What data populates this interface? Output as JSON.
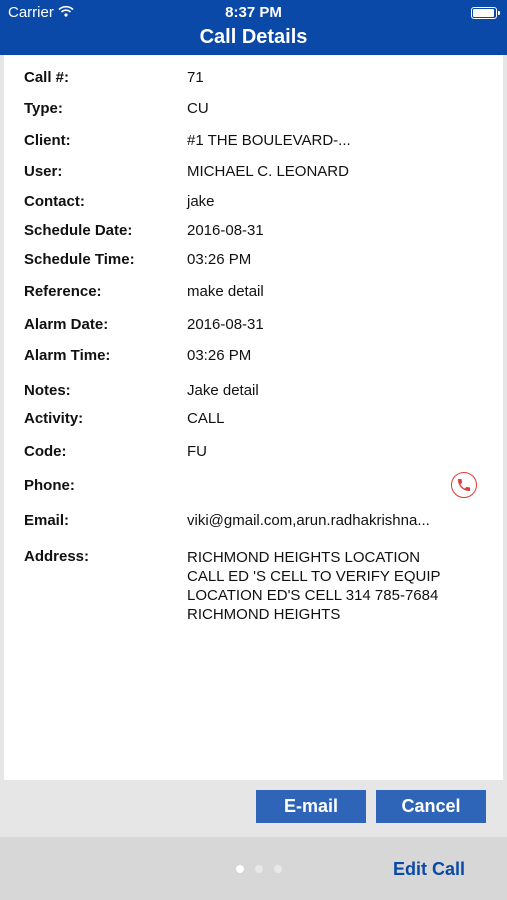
{
  "status_bar": {
    "carrier": "Carrier",
    "time": "8:37 PM",
    "battery_level": 1.0
  },
  "nav": {
    "title": "Call Details"
  },
  "details": [
    {
      "label": "Call #:",
      "value": "71"
    },
    {
      "label": "Type:",
      "value": "CU"
    },
    {
      "label": "Client:",
      "value": "#1 THE BOULEVARD-..."
    },
    {
      "label": "User:",
      "value": "MICHAEL C. LEONARD"
    },
    {
      "label": "Contact:",
      "value": "jake"
    },
    {
      "label": "Schedule Date:",
      "value": "2016-08-31"
    },
    {
      "label": "Schedule Time:",
      "value": "03:26 PM"
    },
    {
      "label": "Reference:",
      "value": "make detail"
    },
    {
      "label": "Alarm Date:",
      "value": "2016-08-31"
    },
    {
      "label": "Alarm Time:",
      "value": "03:26 PM"
    },
    {
      "label": "Notes:",
      "value": "Jake detail"
    },
    {
      "label": "Activity:",
      "value": "CALL"
    },
    {
      "label": "Code:",
      "value": "FU"
    },
    {
      "label": "Phone:",
      "value": ""
    },
    {
      "label": "Email:",
      "value": "viki@gmail.com,arun.radhakrishna..."
    }
  ],
  "address": {
    "label": "Address:",
    "lines": [
      "RICHMOND HEIGHTS LOCATION",
      "CALL ED 'S CELL TO VERIFY EQUIP",
      "LOCATION ED'S CELL 314 785-7684",
      "RICHMOND HEIGHTS"
    ]
  },
  "buttons": {
    "email": "E-mail",
    "cancel": "Cancel"
  },
  "footer": {
    "edit_call": "Edit Call",
    "page_count": 3,
    "current_page": 1
  },
  "colors": {
    "nav_bg": "#0b49a8",
    "button_bg": "#2f65b8",
    "phone_icon": "#e53935",
    "link": "#0b49a8"
  }
}
